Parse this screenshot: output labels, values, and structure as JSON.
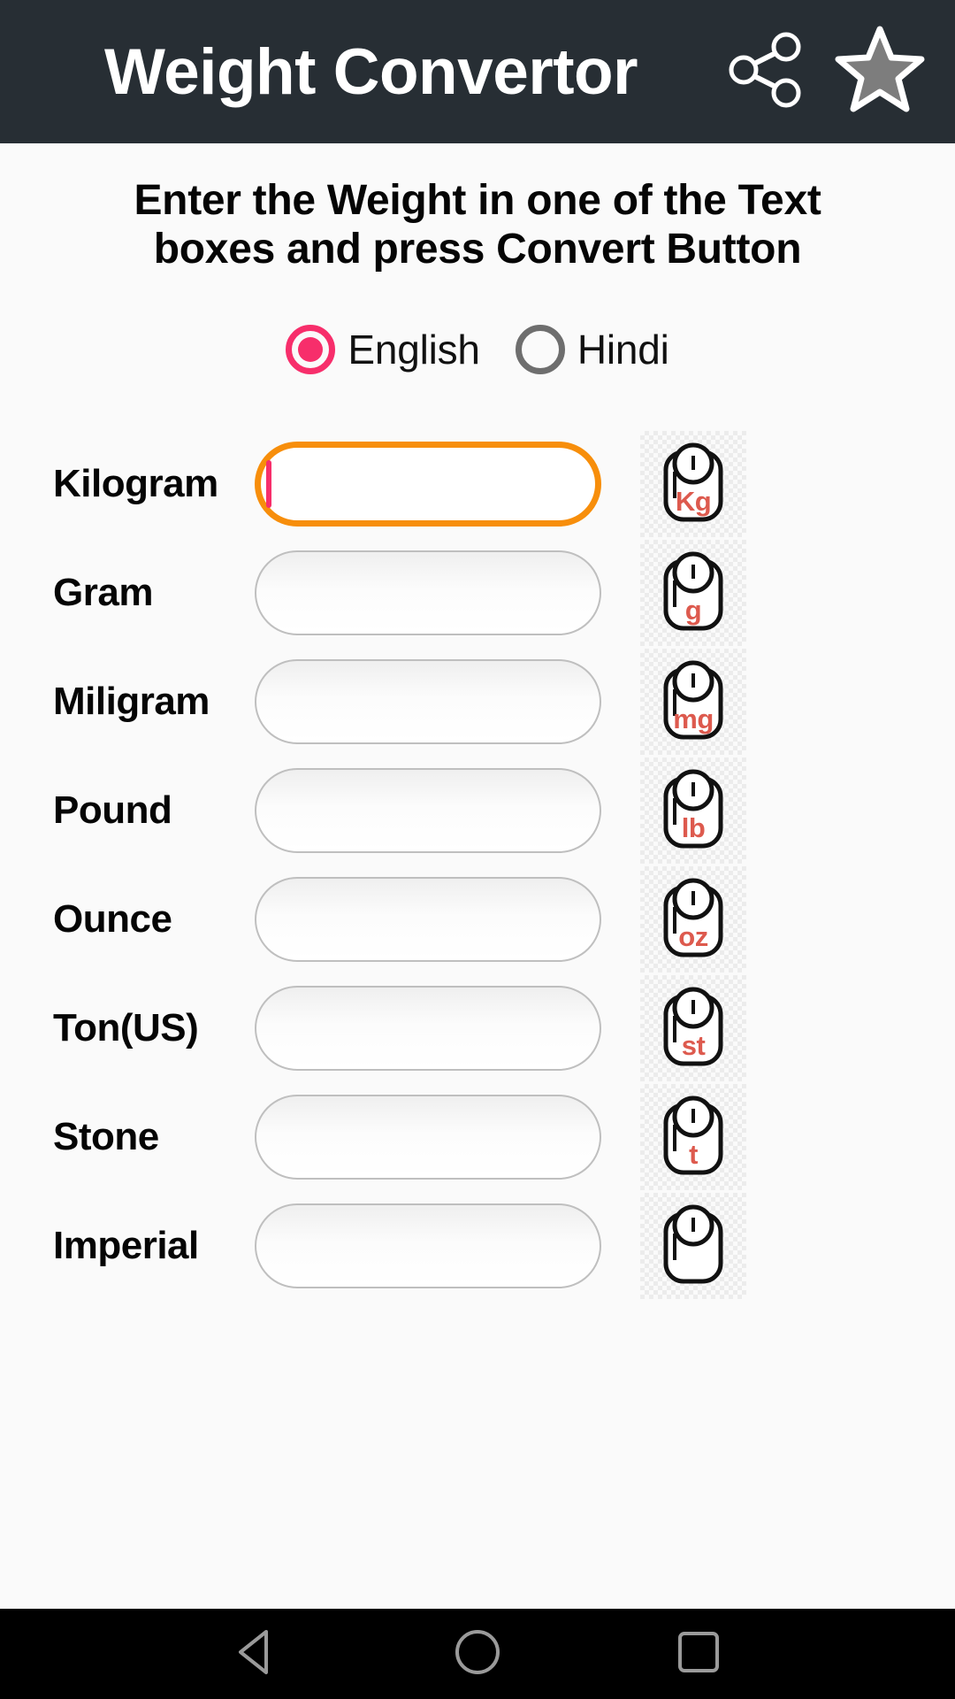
{
  "header": {
    "title": "Weight Convertor",
    "background_color": "#272E34",
    "title_color": "#FFFFFF",
    "actions": [
      {
        "name": "share-icon",
        "label": "Share"
      },
      {
        "name": "star-icon",
        "label": "Rate"
      }
    ]
  },
  "instruction": "Enter the Weight in one of the Text boxes and press Convert Button",
  "language": {
    "selected": "English",
    "selected_color": "#F72E6B",
    "unselected_color": "#6E6E6E",
    "options": [
      {
        "label": "English",
        "checked": true
      },
      {
        "label": "Hindi",
        "checked": false
      }
    ]
  },
  "colors": {
    "page_background": "#FAFAFA",
    "active_field_border": "#F78E0B",
    "inactive_field_border": "#BFBFBF",
    "unit_text": "#DD5A4E",
    "caret": "#F72E6B"
  },
  "rows": [
    {
      "label": "Kilogram",
      "value": "",
      "placeholder": "",
      "unit_icon": "Kg",
      "active": true
    },
    {
      "label": "Gram",
      "value": "",
      "placeholder": "",
      "unit_icon": "g",
      "active": false
    },
    {
      "label": "Miligram",
      "value": "",
      "placeholder": "",
      "unit_icon": "mg",
      "active": false
    },
    {
      "label": "Pound",
      "value": "",
      "placeholder": "",
      "unit_icon": "lb",
      "active": false
    },
    {
      "label": "Ounce",
      "value": "",
      "placeholder": "",
      "unit_icon": "oz",
      "active": false
    },
    {
      "label": "Ton(US)",
      "value": "",
      "placeholder": "",
      "unit_icon": "st",
      "active": false
    },
    {
      "label": "Stone",
      "value": "",
      "placeholder": "",
      "unit_icon": "t",
      "active": false
    },
    {
      "label": "Imperial",
      "value": "",
      "placeholder": "",
      "unit_icon": "",
      "active": false
    }
  ],
  "navbar": {
    "background_color": "#000000",
    "buttons": [
      {
        "name": "android-back-button",
        "label": "Back"
      },
      {
        "name": "android-home-button",
        "label": "Home"
      },
      {
        "name": "android-recents-button",
        "label": "Recents"
      }
    ]
  }
}
